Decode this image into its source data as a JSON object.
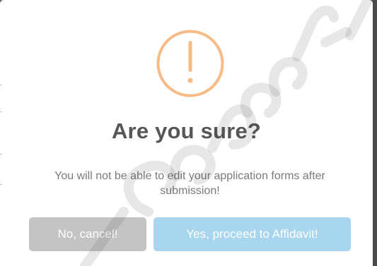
{
  "dialog": {
    "title": "Are you sure?",
    "message": "You will not be able to edit your application forms after submission!",
    "icon": "exclamation-circle-icon",
    "cancel_label": "No, cancel!",
    "confirm_label": "Yes, proceed to Affidavit!"
  },
  "colors": {
    "warning_accent": "#f8bb86",
    "cancel_button": "#c4c4c4",
    "confirm_button": "#a8d6ef",
    "title": "#565656",
    "message": "#7a7a7a"
  }
}
